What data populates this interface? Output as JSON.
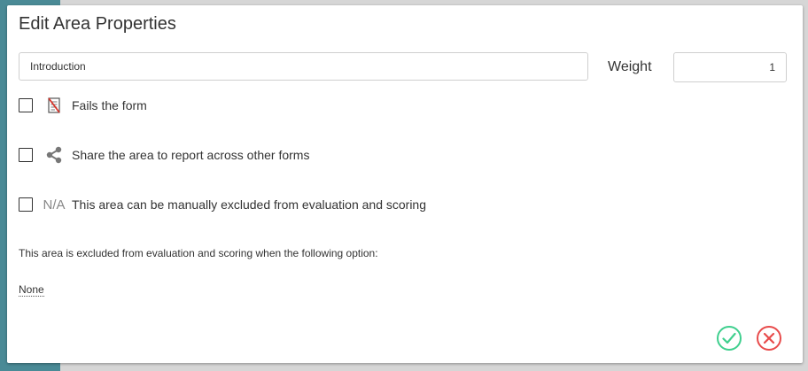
{
  "dialog": {
    "title": "Edit Area Properties",
    "area_name_value": "Introduction",
    "weight_label": "Weight",
    "weight_value": "1"
  },
  "options": [
    {
      "label": "Fails the form",
      "icon": "fails-form-icon",
      "checked": false
    },
    {
      "label": "Share the area to report across other forms",
      "icon": "share-icon",
      "checked": false
    },
    {
      "label": "This area can be manually excluded from evaluation and scoring",
      "icon": "na-icon",
      "icon_text": "N/A",
      "checked": false
    }
  ],
  "exclusion": {
    "text": "This area is excluded from evaluation and scoring when the following option:",
    "selected": "None"
  },
  "colors": {
    "confirm": "#3fcf8e",
    "cancel": "#e84b4b",
    "sidebar": "#4a8a96"
  }
}
